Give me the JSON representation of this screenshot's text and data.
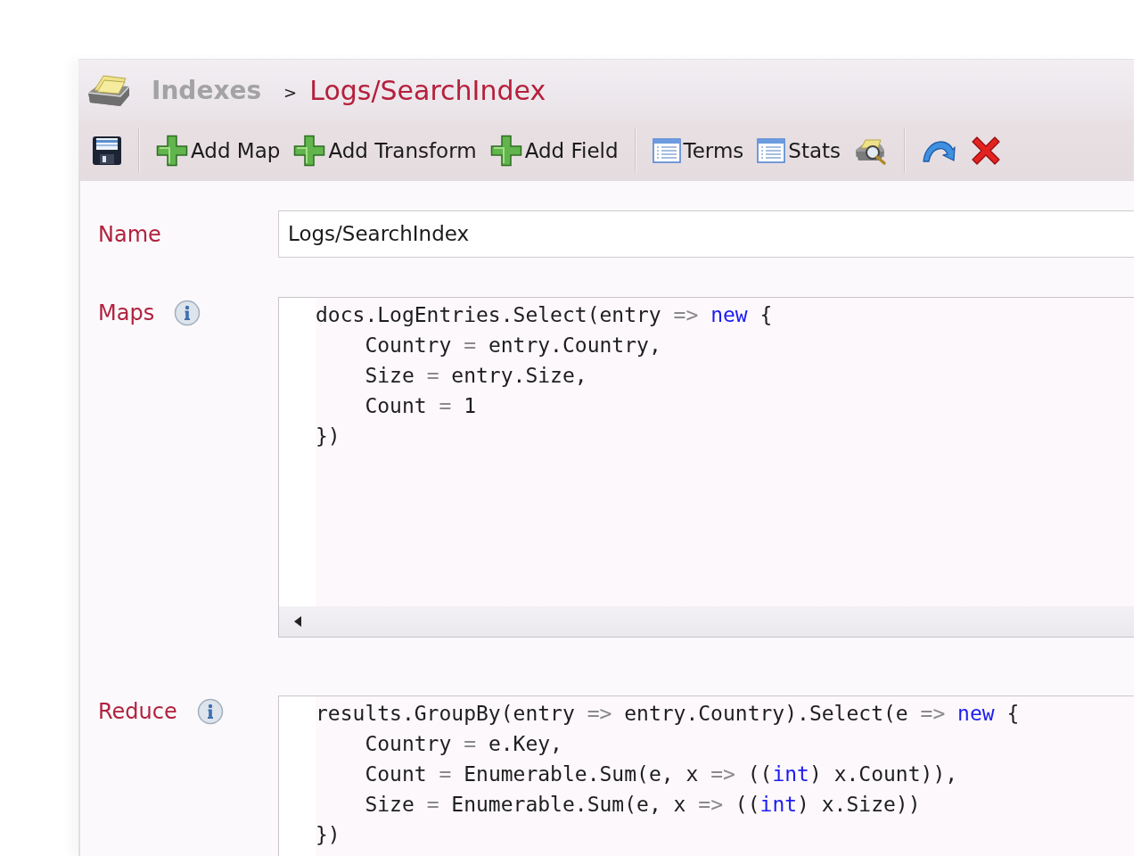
{
  "header": {
    "breadcrumb": {
      "parent": "Indexes",
      "separator": ">",
      "current": "Logs/SearchIndex"
    }
  },
  "toolbar": {
    "groups": [
      {
        "items": [
          {
            "kind": "save"
          }
        ]
      },
      {
        "items": [
          {
            "kind": "add",
            "label": "Add Map"
          },
          {
            "kind": "add",
            "label": "Add Transform"
          },
          {
            "kind": "add",
            "label": "Add Field"
          }
        ]
      },
      {
        "items": [
          {
            "kind": "list",
            "label": "Terms"
          },
          {
            "kind": "list",
            "label": "Stats"
          },
          {
            "kind": "query"
          }
        ]
      },
      {
        "items": [
          {
            "kind": "revert"
          },
          {
            "kind": "delete"
          }
        ]
      }
    ]
  },
  "form": {
    "fields": [
      {
        "kind": "text",
        "label": "Name",
        "value": "Logs/SearchIndex"
      },
      {
        "kind": "code",
        "label": "Maps",
        "info": true,
        "lines": [
          {
            "tokens": [
              {
                "kind": "plain",
                "text": "docs.LogEntries.Select(entry "
              },
              {
                "kind": "operator",
                "text": "=>"
              },
              {
                "kind": "keyword",
                "text": " new"
              },
              {
                "kind": "plain",
                "text": " {"
              }
            ]
          },
          {
            "tokens": [
              {
                "kind": "plain",
                "text": "    Country "
              },
              {
                "kind": "operator",
                "text": "="
              },
              {
                "kind": "plain",
                "text": " entry.Country,"
              }
            ]
          },
          {
            "tokens": [
              {
                "kind": "plain",
                "text": "    Size "
              },
              {
                "kind": "operator",
                "text": "="
              },
              {
                "kind": "plain",
                "text": " entry.Size,"
              }
            ]
          },
          {
            "tokens": [
              {
                "kind": "plain",
                "text": "    Count "
              },
              {
                "kind": "operator",
                "text": "="
              },
              {
                "kind": "plain",
                "text": " 1"
              }
            ]
          },
          {
            "tokens": [
              {
                "kind": "plain",
                "text": "})"
              }
            ]
          }
        ]
      },
      {
        "kind": "code",
        "label": "Reduce",
        "info": true,
        "lines": [
          {
            "tokens": [
              {
                "kind": "plain",
                "text": "results.GroupBy(entry "
              },
              {
                "kind": "operator",
                "text": "=>"
              },
              {
                "kind": "plain",
                "text": " entry.Country).Select(e "
              },
              {
                "kind": "operator",
                "text": "=>"
              },
              {
                "kind": "keyword",
                "text": " new"
              },
              {
                "kind": "plain",
                "text": " {"
              }
            ]
          },
          {
            "tokens": [
              {
                "kind": "plain",
                "text": "    Country "
              },
              {
                "kind": "operator",
                "text": "="
              },
              {
                "kind": "plain",
                "text": " e.Key,"
              }
            ]
          },
          {
            "tokens": [
              {
                "kind": "plain",
                "text": "    Count "
              },
              {
                "kind": "operator",
                "text": "="
              },
              {
                "kind": "plain",
                "text": " Enumerable.Sum(e, x "
              },
              {
                "kind": "operator",
                "text": "=>"
              },
              {
                "kind": "plain",
                "text": " (("
              },
              {
                "kind": "keyword",
                "text": "int"
              },
              {
                "kind": "plain",
                "text": ") x.Count)),"
              }
            ]
          },
          {
            "tokens": [
              {
                "kind": "plain",
                "text": "    Size "
              },
              {
                "kind": "operator",
                "text": "="
              },
              {
                "kind": "plain",
                "text": " Enumerable.Sum(e, x "
              },
              {
                "kind": "operator",
                "text": "=>"
              },
              {
                "kind": "plain",
                "text": " (("
              },
              {
                "kind": "keyword",
                "text": "int"
              },
              {
                "kind": "plain",
                "text": ") x.Size))"
              }
            ]
          },
          {
            "tokens": [
              {
                "kind": "plain",
                "text": "})"
              }
            ]
          }
        ]
      }
    ]
  }
}
